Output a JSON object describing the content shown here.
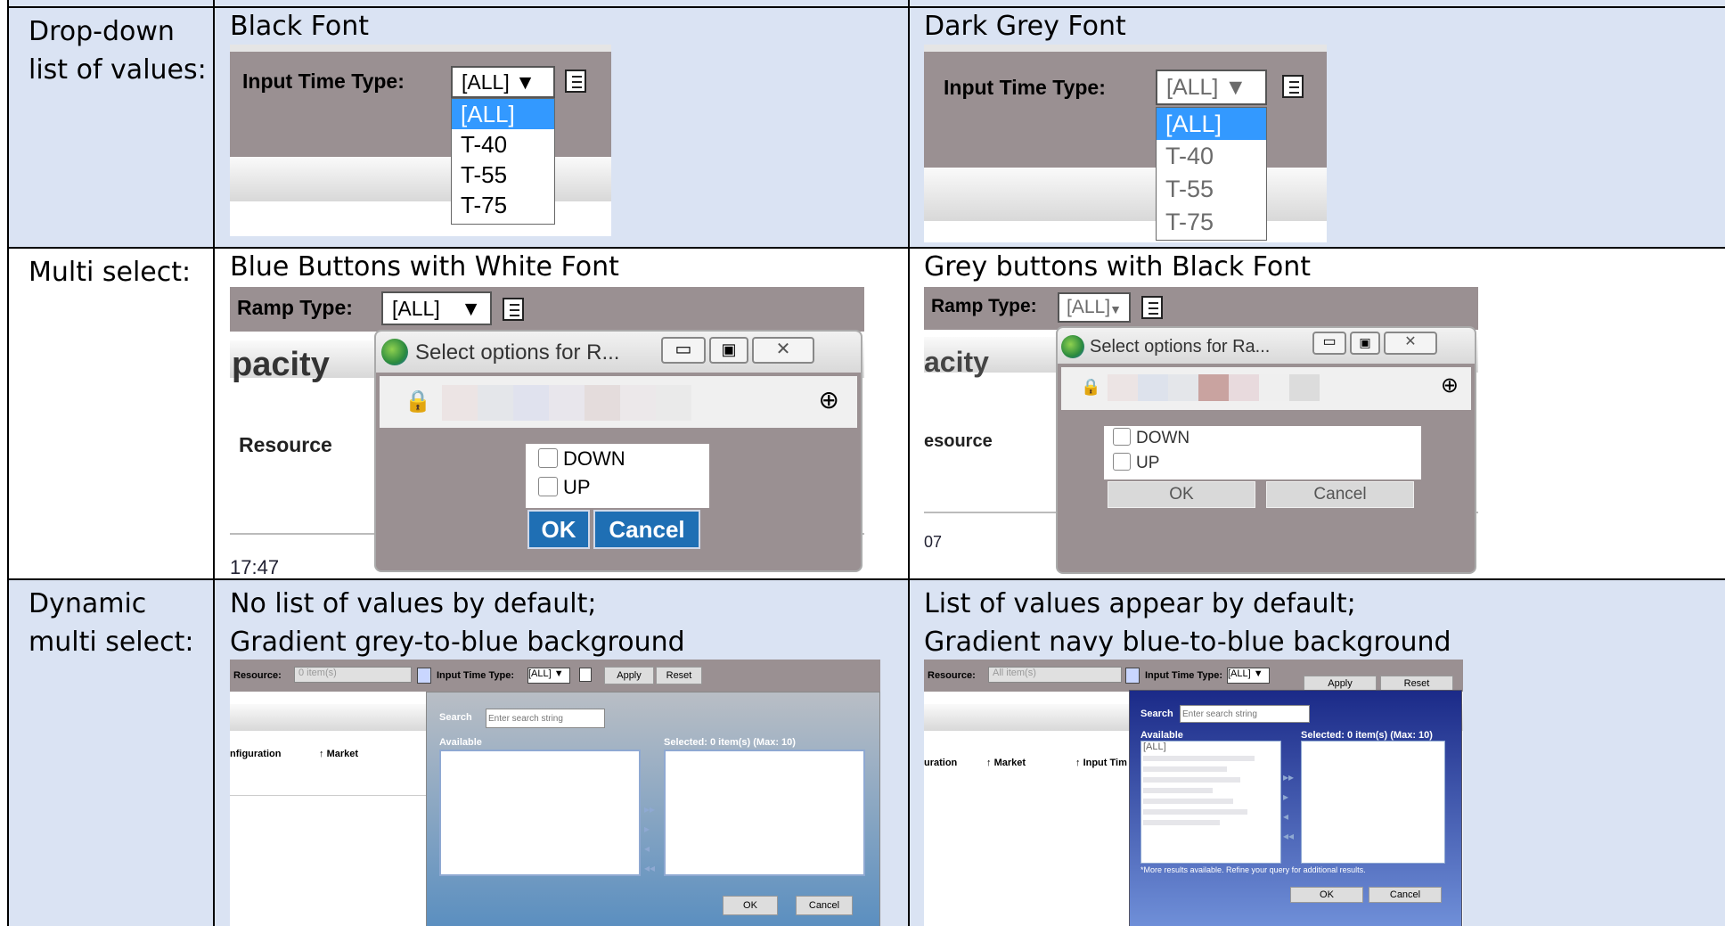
{
  "rows": [
    {
      "label": [
        "Drop-down",
        "list of values:"
      ],
      "left_heading": "Black Font",
      "right_heading": "Dark Grey Font",
      "dropdown": {
        "field_label": "Input Time Type:",
        "selected": "[ALL] ▼",
        "selected_right": "[ALL] ▼",
        "options": [
          "[ALL]",
          "T-40",
          "T-55",
          "T-75"
        ]
      }
    },
    {
      "label": [
        "Multi select:"
      ],
      "left_heading": "Blue Buttons with White Font",
      "right_heading": "Grey buttons with Black Font",
      "multiselect": {
        "field_label": "Ramp Type:",
        "selected": "[ALL]",
        "dialog_title_left": "Select options for R...",
        "dialog_title_right": "Select options for Ra...",
        "bg_text_left": "pacity",
        "bg_text_right": "acity",
        "resource_left": "Resource",
        "resource_right": "esource",
        "time_left": "17:47",
        "time_right": "07",
        "options": [
          "DOWN",
          "UP"
        ],
        "ok": "OK",
        "cancel": "Cancel"
      }
    },
    {
      "label": [
        "Dynamic",
        "multi select:"
      ],
      "left_heading": [
        "No list of values by default;",
        "Gradient grey-to-blue background"
      ],
      "right_heading": [
        "List of values appear by default;",
        "Gradient navy blue-to-blue background"
      ],
      "dynamic": {
        "resource_label": "Resource:",
        "resource_value_left": "0 item(s)",
        "resource_value_right": "All item(s)",
        "input_time_label": "Input Time Type:",
        "input_time_value": "[ALL] ▼",
        "apply": "Apply",
        "reset": "Reset",
        "search_label": "Search",
        "search_placeholder": "Enter search string",
        "available": "Available",
        "selected_left": "Selected: 0 item(s) (Max: 10)",
        "selected_right": "Selected: 0 item(s) (Max: 10)",
        "col_left_1": "nfiguration",
        "col_left_2": "Market",
        "col_right_1": "uration",
        "col_right_2": "Market",
        "col_right_3": "Input Tim",
        "all_item": "[ALL]",
        "more_results": "*More results available. Refine your query for additional results.",
        "ok": "OK",
        "cancel": "Cancel"
      }
    }
  ],
  "colors": {
    "cell_bg": "#dae3f3",
    "toolbar_grey": "#9a9092",
    "blue_button": "#1f6fb4",
    "selection_blue": "#3399ff"
  }
}
